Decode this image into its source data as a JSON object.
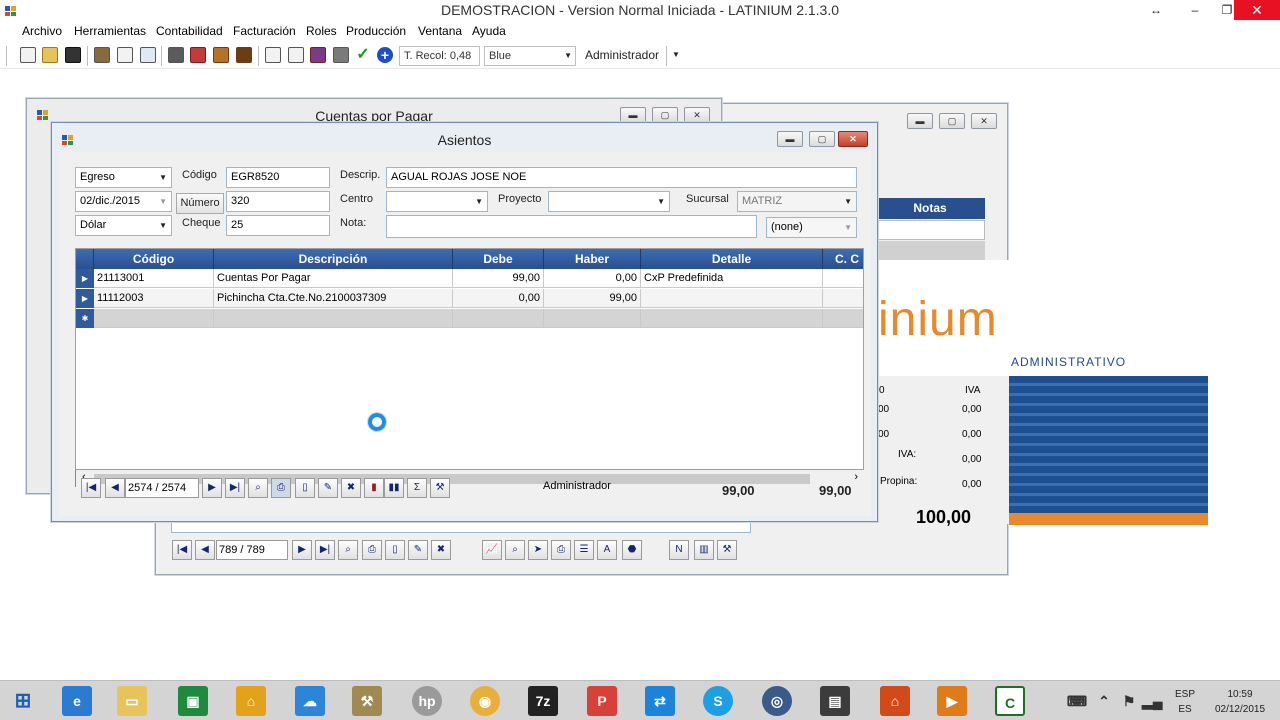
{
  "app": {
    "title": "DEMOSTRACION - Version Normal Iniciada  - LATINIUM 2.1.3.0",
    "ctrl_restore": "↔",
    "ctrl_min": "–",
    "ctrl_max": "❐",
    "ctrl_close": "✕"
  },
  "menu": [
    "Archivo",
    "Herramientas",
    "Contabilidad",
    "Facturación",
    "Roles",
    "Producción",
    "Ventana",
    "Ayuda"
  ],
  "toolbar": {
    "t_recol": "T. Recol: 0,48",
    "theme": "Blue",
    "user": "Administrador"
  },
  "cxp_window": {
    "title": "Cuentas por Pagar"
  },
  "back_window": {
    "notas_header": "Notas",
    "logo_text": "inium",
    "logo_sub": "ADMINISTRATIVO",
    "lbl_0": "0",
    "lbl_iva": "IVA",
    "lbl_00_a": "00",
    "lbl_00_b": "00",
    "lbl_iva2": "IVA:",
    "lbl_propina": "Propina:",
    "vals": [
      "0,00",
      "0,00",
      "0,00",
      "0,00"
    ],
    "total": "100,00",
    "nav_position": "789 / 789",
    "nav_n": "N",
    "nav_a": "A"
  },
  "asientos": {
    "title": "Asientos",
    "tipo": "Egreso",
    "fecha": "02/dic./2015",
    "moneda": "Dólar",
    "lbl_codigo": "Código",
    "codigo": "EGR8520",
    "btn_numero": "Número",
    "numero": "320",
    "lbl_cheque": "Cheque",
    "cheque": "25",
    "lbl_descrip": "Descrip.",
    "descrip": "AGUAL ROJAS JOSE NOE",
    "lbl_centro": "Centro",
    "lbl_proyecto": "Proyecto",
    "lbl_sucursal": "Sucursal",
    "sucursal": "MATRIZ",
    "lbl_nota": "Nota:",
    "none_combo": "(none)",
    "grid": {
      "headers": [
        "Código",
        "Descripción",
        "Debe",
        "Haber",
        "Detalle",
        "C. C"
      ],
      "rows": [
        {
          "codigo": "21113001",
          "descripcion": "Cuentas  Por Pagar",
          "debe": "99,00",
          "haber": "0,00",
          "detalle": "CxP Predefinida"
        },
        {
          "codigo": "11112003",
          "descripcion": "Pichincha Cta.Cte.No.2100037309",
          "debe": "0,00",
          "haber": "99,00",
          "detalle": ""
        }
      ]
    },
    "nav_position": "2574 / 2574",
    "footer_user": "Administrador",
    "total_debe": "99,00",
    "total_haber": "99,00"
  },
  "taskbar": {
    "lang1": "ESP",
    "lang2": "ES",
    "time": "10:59",
    "date": "02/12/2015"
  }
}
